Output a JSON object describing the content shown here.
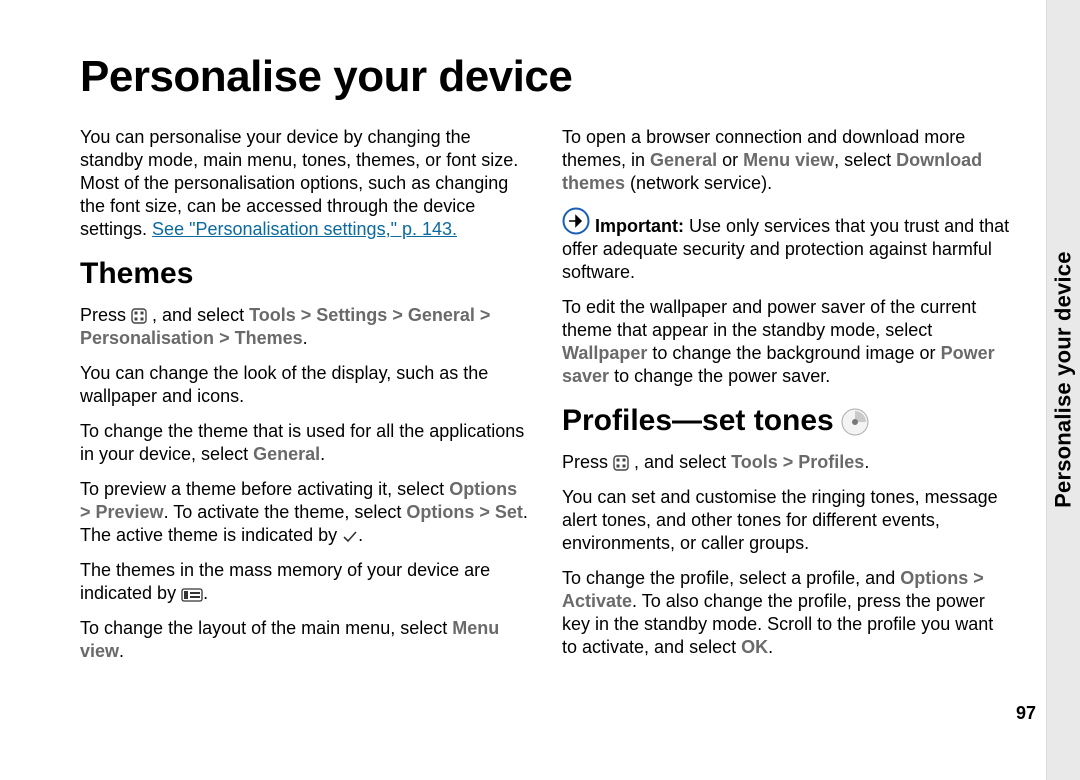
{
  "chapter_title": "Personalise your device",
  "thumb_label": "Personalise your device",
  "page_number": "97",
  "intro": {
    "p1_a": "You can personalise your device by changing the standby mode, main menu, tones, themes, or font size. Most of the personalisation options, such as changing the font size, can be accessed through the device settings. ",
    "link": "See \"Personalisation settings,\" p. 143."
  },
  "themes": {
    "heading": "Themes",
    "p1_a": "Press ",
    "p1_b": " , and select ",
    "nav1": "Tools",
    "gt": " > ",
    "nav2": "Settings",
    "nav3": "General",
    "nav4": "Personalisation",
    "nav5": "Themes",
    "p1_c": ".",
    "p2": "You can change the look of the display, such as the wallpaper and icons.",
    "p3_a": "To change the theme that is used for all the applications in your device, select ",
    "p3_b": "General",
    "p3_c": ".",
    "p4_a": "To preview a theme before activating it, select ",
    "p4_b": "Options",
    "p4_c": "Preview",
    "p4_d": ". To activate the theme, select ",
    "p4_e": "Options",
    "p4_f": "Set",
    "p4_g": ". The active theme is indicated by ",
    "p4_h": ".",
    "p5_a": "The themes in the mass memory of your device are indicated by ",
    "p5_b": ".",
    "p6_a": "To change the layout of the main menu, select ",
    "p6_b": "Menu view",
    "p6_c": "."
  },
  "col2": {
    "p1_a": "To open a browser connection and download more themes, in ",
    "p1_b": "General",
    "p1_c": " or ",
    "p1_d": "Menu view",
    "p1_e": ", select ",
    "p1_f": "Download themes",
    "p1_g": " (network service).",
    "imp_label": "Important:",
    "imp_text": "  Use only services that you trust and that offer adequate security and protection against harmful software.",
    "p3_a": "To edit the wallpaper and power saver of the current theme that appear in the standby mode, select ",
    "p3_b": "Wallpaper",
    "p3_c": " to change the background image or ",
    "p3_d": "Power saver",
    "p3_e": " to change the power saver."
  },
  "profiles": {
    "heading": "Profiles—set tones",
    "p1_a": "Press ",
    "p1_b": " , and select ",
    "nav1": "Tools",
    "nav2": "Profiles",
    "p1_c": ".",
    "p2": "You can set and customise the ringing tones, message alert tones, and other tones for different events, environments, or caller groups.",
    "p3_a": "To change the profile, select a profile, and ",
    "p3_b": "Options",
    "p3_c": "Activate",
    "p3_d": ". To also change the profile, press the power key in the standby mode. Scroll to the profile you want to activate, and select ",
    "p3_e": "OK",
    "p3_f": "."
  }
}
